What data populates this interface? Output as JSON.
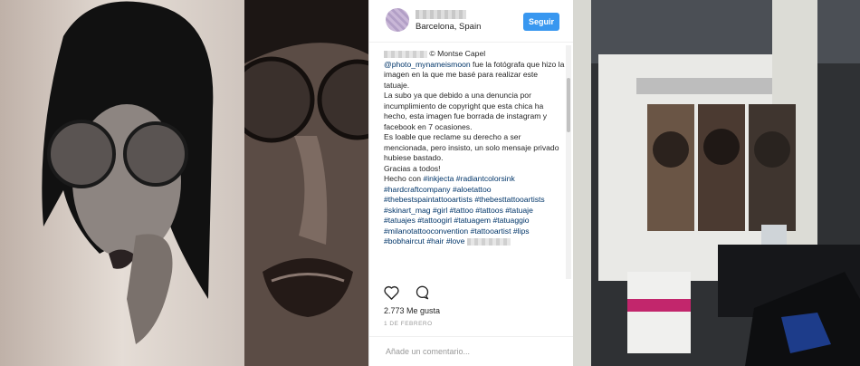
{
  "post": {
    "location": "Barcelona, Spain",
    "follow_label": "Seguir",
    "caption": {
      "line1_after_blur": " © Montse Capel",
      "mention": "@photo_mynameismoon",
      "p1_rest": " fue la fotógrafa que hizo la imagen en la que me basé para realizar este tatuaje.",
      "p2": "La subo ya que debido a una denuncia por incumplimiento de copyright que esta chica ha hecho, esta imagen fue borrada de instagram y facebook en 7 ocasiones.",
      "p3": "Es loable que reclame su derecho a ser mencionada, pero insisto, un solo mensaje privado hubiese bastado.",
      "p4": "Gracias a todos!",
      "p5_prefix": "Hecho con ",
      "hashtags": [
        "#inkjecta",
        "#radiantcolorsink",
        "#hardcraftcompany",
        "#aloetattoo",
        "#thebestspaintattooartists",
        "#thebesttattooartists",
        "#skinart_mag",
        "#girl",
        "#tattoo",
        "#tattoos",
        "#tatuaje",
        "#tatuajes",
        "#tattoogirl",
        "#tatuagem",
        "#tatuaggio",
        "#milanotattooconvention",
        "#tattooartist",
        "#lips",
        "#bobhaircut",
        "#hair",
        "#love"
      ]
    },
    "likes": "2.773 Me gusta",
    "date": "1 DE FEBRERO",
    "comment_placeholder": "Añade un comentario..."
  },
  "colors": {
    "accent": "#3897f0",
    "hashtag": "#003569"
  },
  "icons": [
    "heart-icon",
    "comment-icon"
  ]
}
